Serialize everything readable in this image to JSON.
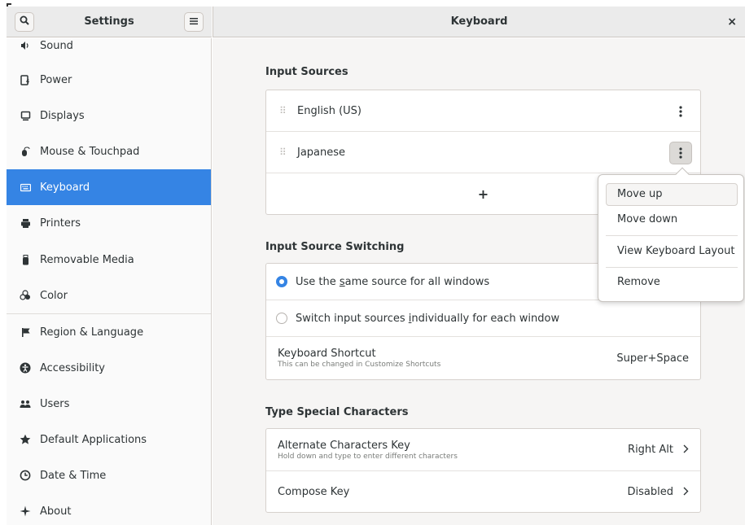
{
  "header": {
    "app_title": "Settings",
    "page_title": "Keyboard",
    "search_icon": "search-icon",
    "menu_icon": "hamburger-menu-icon",
    "close_glyph": "×"
  },
  "sidebar": {
    "items": [
      {
        "label": "Sound",
        "icon": "speaker-icon"
      },
      {
        "label": "Power",
        "icon": "battery-icon"
      },
      {
        "label": "Displays",
        "icon": "monitor-icon"
      },
      {
        "label": "Mouse & Touchpad",
        "icon": "mouse-icon"
      },
      {
        "label": "Keyboard",
        "icon": "keyboard-icon",
        "selected": true
      },
      {
        "label": "Printers",
        "icon": "printer-icon"
      },
      {
        "label": "Removable Media",
        "icon": "usb-icon"
      },
      {
        "label": "Color",
        "icon": "color-icon"
      },
      {
        "label": "Region & Language",
        "icon": "flag-icon"
      },
      {
        "label": "Accessibility",
        "icon": "accessibility-icon"
      },
      {
        "label": "Users",
        "icon": "users-icon"
      },
      {
        "label": "Default Applications",
        "icon": "star-icon"
      },
      {
        "label": "Date & Time",
        "icon": "clock-icon"
      },
      {
        "label": "About",
        "icon": "about-icon"
      }
    ]
  },
  "input_sources": {
    "title": "Input Sources",
    "sources": [
      {
        "label": "English (US)"
      },
      {
        "label": "Japanese"
      }
    ],
    "add_glyph": "+"
  },
  "switching": {
    "title": "Input Source Switching",
    "option_same_pre": "Use the ",
    "option_same_ul": "s",
    "option_same_post": "ame source for all windows",
    "option_individual_pre": "Switch input sources ",
    "option_individual_ul": "i",
    "option_individual_post": "ndividually for each window",
    "selected": "same",
    "shortcut_label": "Keyboard Shortcut",
    "shortcut_sub": "This can be changed in Customize Shortcuts",
    "shortcut_value": "Super+Space"
  },
  "special_chars": {
    "title": "Type Special Characters",
    "alt_label": "Alternate Characters Key",
    "alt_sub": "Hold down and type to enter different characters",
    "alt_value": "Right Alt",
    "compose_label": "Compose Key",
    "compose_value": "Disabled"
  },
  "popover": {
    "move_up": "Move up",
    "move_down": "Move down",
    "view_layout": "View Keyboard Layout",
    "remove": "Remove"
  },
  "colors": {
    "accent": "#3584e4",
    "sidebar_bg": "#fafafa",
    "content_bg": "#f6f5f4",
    "headerbar_bg": "#ebebeb"
  }
}
